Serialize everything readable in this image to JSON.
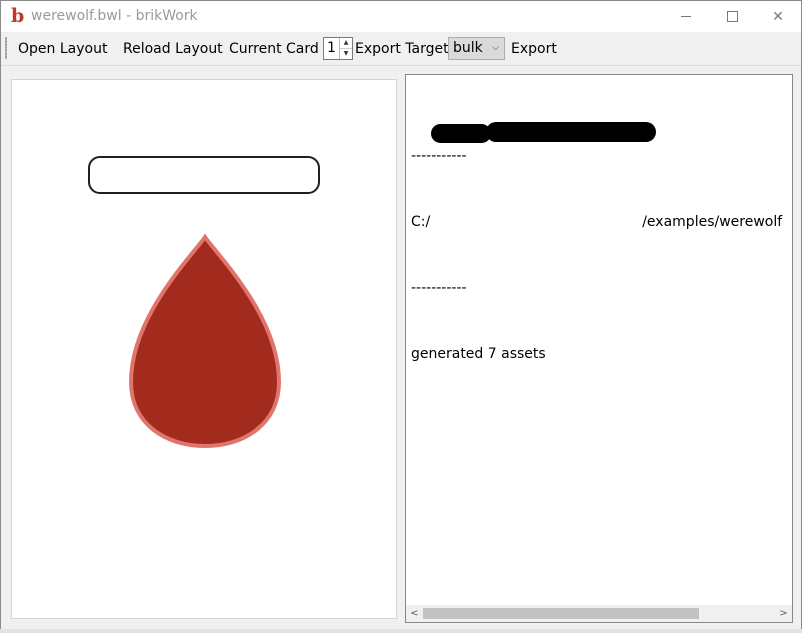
{
  "window": {
    "app_icon": "b",
    "title": "werewolf.bwl - brikWork",
    "controls": {
      "minimize": "minimize-icon",
      "maximize": "maximize-icon",
      "close": "close-icon",
      "close_glyph": "✕"
    }
  },
  "toolbar": {
    "open_layout": "Open Layout",
    "reload_layout": "Reload Layout",
    "current_card_label": "Current Card",
    "current_card_value": "1",
    "spin_up": "▲",
    "spin_down": "▼",
    "export_target_label": "Export Target",
    "export_target_value": "bulk",
    "export_target_arrow": "⌵",
    "export": "Export"
  },
  "preview": {
    "drop_fill": "#a32b1e",
    "drop_stroke": "#e0756b"
  },
  "log": {
    "line1": "-----------",
    "line2_prefix": "C:/",
    "line2_suffix": "/examples/werewolf",
    "line3": "-----------",
    "line4": "generated 7 assets"
  },
  "scrollbar": {
    "left_arrow": "<",
    "right_arrow": ">"
  }
}
